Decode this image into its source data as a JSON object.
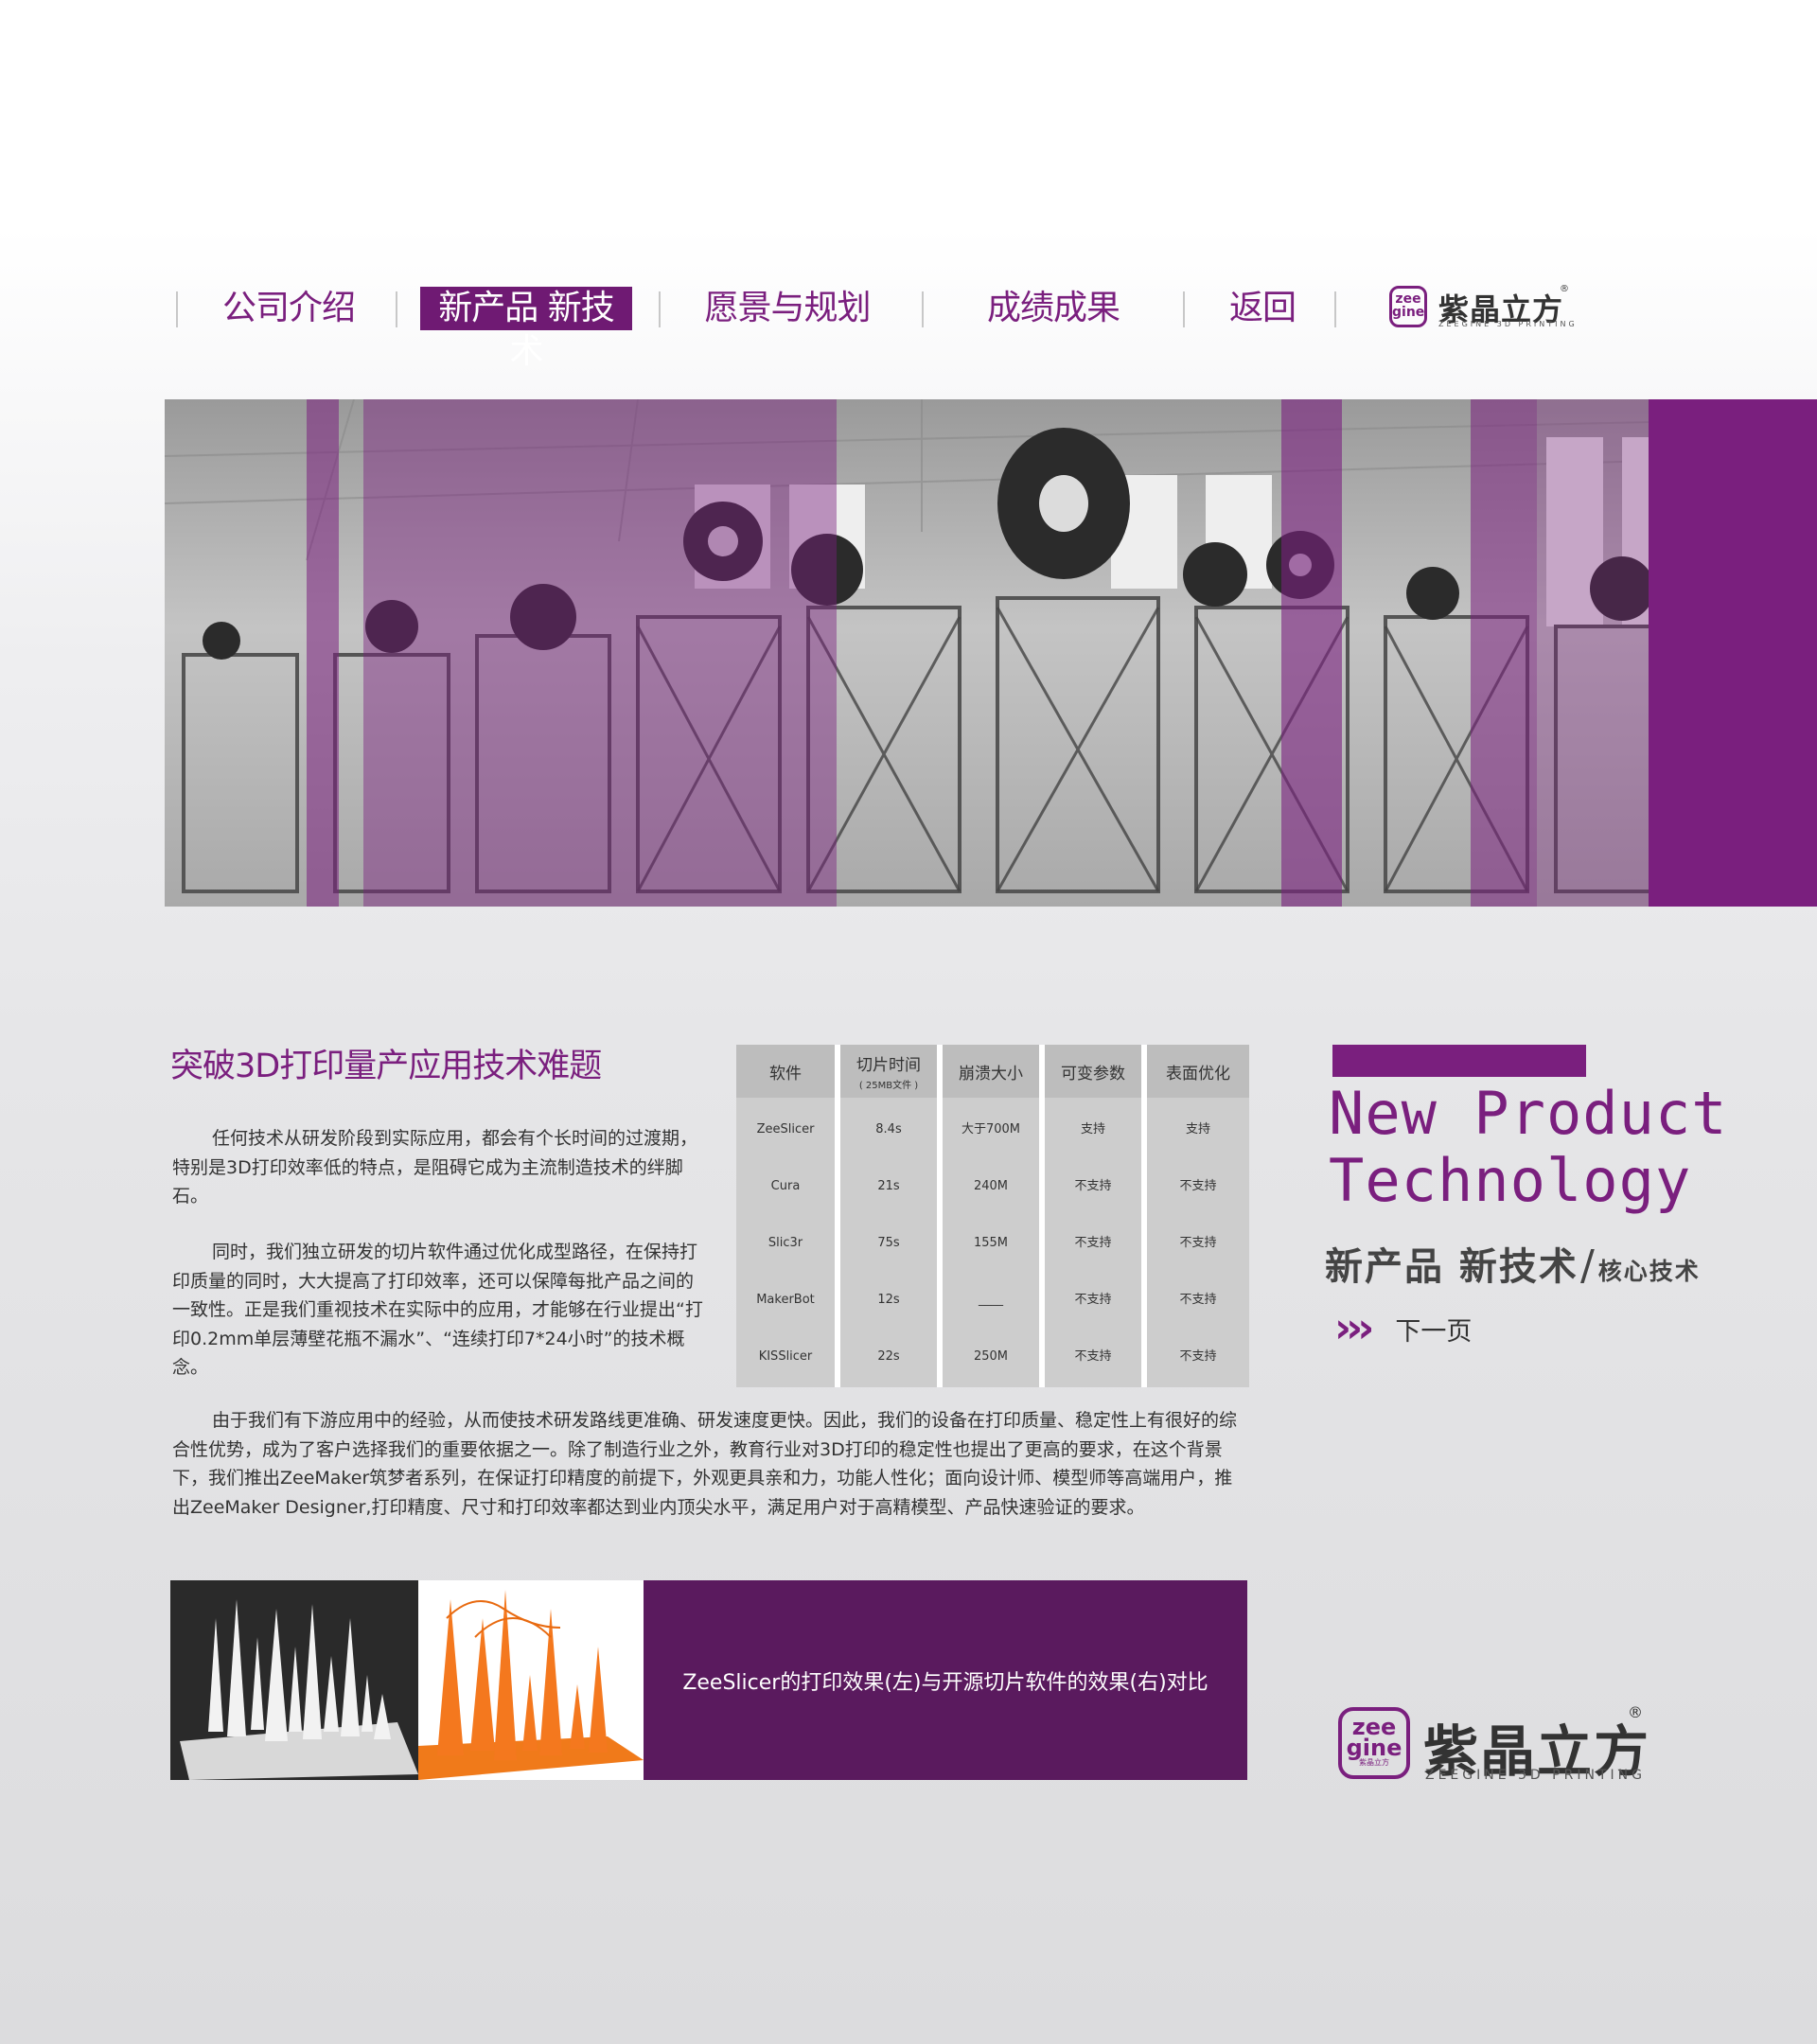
{
  "nav": {
    "items": [
      {
        "label": "公司介绍",
        "active": false
      },
      {
        "label": "新产品 新技术",
        "active": true
      },
      {
        "label": "愿景与规划",
        "active": false
      },
      {
        "label": "成绩成果",
        "active": false
      },
      {
        "label": "返回",
        "active": false
      }
    ]
  },
  "brand": {
    "name_cn": "紫晶立方",
    "name_en": "ZEEGINE 3D PRINTING",
    "mark_top": "zee",
    "mark_bottom": "gine",
    "mark_tiny": "紫晶立方",
    "registered": "®"
  },
  "colors": {
    "accent": "#7a1f7e",
    "caption_bg": "#5a1a5e"
  },
  "article": {
    "title": "突破3D打印量产应用技术难题",
    "paragraphs": [
      "任何技术从研发阶段到实际应用，都会有个长时间的过渡期，特别是3D打印效率低的特点，是阻碍它成为主流制造技术的绊脚石。",
      "同时，我们独立研发的切片软件通过优化成型路径，在保持打印质量的同时，大大提高了打印效率，还可以保障每批产品之间的一致性。正是我们重视技术在实际中的应用，才能够在行业提出“打印0.2mm单层薄壁花瓶不漏水”、“连续打印7*24小时”的技术概念。",
      "由于我们有下游应用中的经验，从而使技术研发路线更准确、研发速度更快。因此，我们的设备在打印质量、稳定性上有很好的综合性优势，成为了客户选择我们的重要依据之一。除了制造行业之外，教育行业对3D打印的稳定性也提出了更高的要求，在这个背景下，我们推出ZeeMaker筑梦者系列，在保证打印精度的前提下，外观更具亲和力，功能人性化；面向设计师、模型师等高端用户，推出ZeeMaker Designer,打印精度、尺寸和打印效率都达到业内顶尖水平，满足用户对于高精模型、产品快速验证的要求。"
    ]
  },
  "comparison": {
    "headers": [
      {
        "label": "软件",
        "sub": ""
      },
      {
        "label": "切片时间",
        "sub": "( 25MB文件 )"
      },
      {
        "label": "崩溃大小",
        "sub": ""
      },
      {
        "label": "可变参数",
        "sub": ""
      },
      {
        "label": "表面优化",
        "sub": ""
      }
    ],
    "rows": [
      [
        "ZeeSlicer",
        "8.4s",
        "大于700M",
        "支持",
        "支持"
      ],
      [
        "Cura",
        "21s",
        "240M",
        "不支持",
        "不支持"
      ],
      [
        "Slic3r",
        "75s",
        "155M",
        "不支持",
        "不支持"
      ],
      [
        "MakerBot",
        "12s",
        "____",
        "不支持",
        "不支持"
      ],
      [
        "KISSlicer",
        "22s",
        "250M",
        "不支持",
        "不支持"
      ]
    ]
  },
  "strip": {
    "caption": "ZeeSlicer的打印效果(左)与开源切片软件的效果(右)对比"
  },
  "side": {
    "heading_line1": "New Product",
    "heading_line2": "Technology",
    "subtitle_main": "新产品  新技术",
    "subtitle_slash": "/",
    "subtitle_small": "核心技术",
    "next_arrows": "›››",
    "next_label": "下一页"
  }
}
